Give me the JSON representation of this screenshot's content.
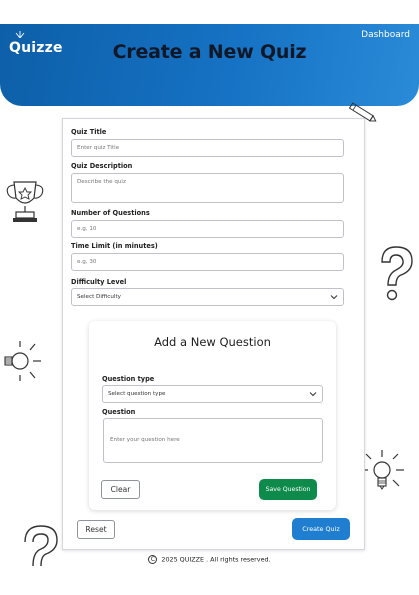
{
  "app": {
    "logo": "Quizze",
    "nav_link": "Dashboard"
  },
  "page": {
    "title": "Create a New Quiz"
  },
  "form": {
    "quiz_title": {
      "label": "Quiz Title",
      "placeholder": "Enter quiz Title"
    },
    "quiz_description": {
      "label": "Quiz Description",
      "placeholder": "Describe the quiz"
    },
    "num_questions": {
      "label": "Number of Questions",
      "placeholder": "e.g, 10"
    },
    "time_limit": {
      "label": "Time Limit (in minutes)",
      "placeholder": "e.g, 30"
    },
    "difficulty": {
      "label": "Difficulty Level",
      "selected": "Select Difficulty"
    }
  },
  "question_card": {
    "title": "Add a New Question",
    "question_type": {
      "label": "Question type",
      "selected": "Select question type"
    },
    "question": {
      "label": "Question",
      "placeholder": "Enter your question here"
    },
    "clear_label": "Clear",
    "save_label": "Save Question"
  },
  "actions": {
    "reset_label": "Reset",
    "create_label": "Create Quiz"
  },
  "footer": {
    "copyright_symbol": "C",
    "text": "2025 QUIZZE . All rights reserved."
  },
  "colors": {
    "header": "#1672c4",
    "save": "#0e8a4b",
    "create": "#1f7ecf"
  }
}
